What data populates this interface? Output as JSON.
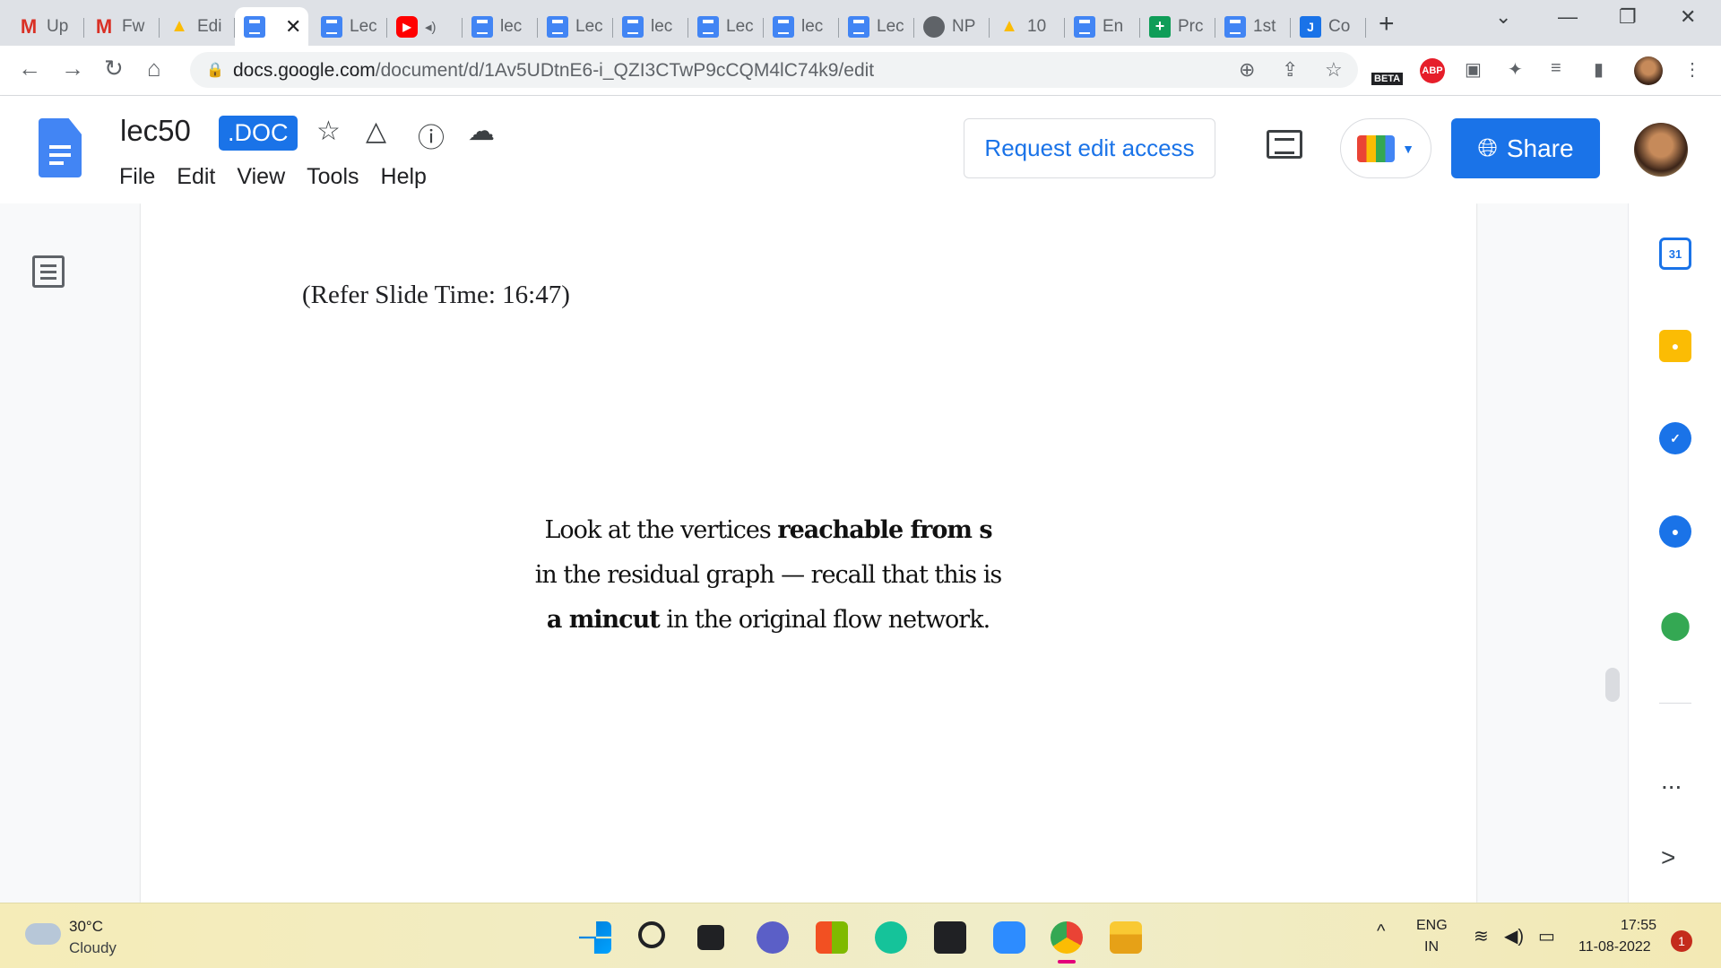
{
  "tabs": [
    {
      "title": "Up",
      "icon": "gmail-icon"
    },
    {
      "title": "Fw",
      "icon": "gmail-icon"
    },
    {
      "title": "Edi",
      "icon": "google-drive-icon"
    },
    {
      "title": "",
      "icon": "google-docs-icon",
      "active": true
    },
    {
      "title": "Lec",
      "icon": "google-docs-icon"
    },
    {
      "title": "",
      "icon": "youtube-icon"
    },
    {
      "title": "lec",
      "icon": "google-docs-icon"
    },
    {
      "title": "Lec",
      "icon": "google-docs-icon"
    },
    {
      "title": "lec",
      "icon": "google-docs-icon"
    },
    {
      "title": "Lec",
      "icon": "google-docs-icon"
    },
    {
      "title": "lec",
      "icon": "google-docs-icon"
    },
    {
      "title": "Lec",
      "icon": "google-docs-icon"
    },
    {
      "title": "NP",
      "icon": "globe-icon"
    },
    {
      "title": "10",
      "icon": "google-drive-icon"
    },
    {
      "title": "En",
      "icon": "google-docs-icon"
    },
    {
      "title": "Prc",
      "icon": "google-sheets-icon"
    },
    {
      "title": "1st",
      "icon": "google-docs-icon"
    },
    {
      "title": "Co",
      "icon": "j-icon"
    }
  ],
  "address_bar": {
    "domain": "docs.google.com",
    "path": "/document/d/1Av5UDtnE6-i_QZI3CTwP9cCQM4lC74k9/edit",
    "beta_label": "BETA",
    "abp_label": "ABP"
  },
  "docs": {
    "title": "lec50",
    "badge": ".DOC",
    "menu": [
      "File",
      "Edit",
      "View",
      "Tools",
      "Help"
    ],
    "request_edit_label": "Request edit access",
    "share_label": "Share"
  },
  "document": {
    "slide_ref": "(Refer Slide Time: 16:47)",
    "slide_lines": [
      {
        "parts": [
          {
            "text": "Look at the vertices ",
            "bold": false
          },
          {
            "text": "reachable from s",
            "bold": true
          }
        ]
      },
      {
        "parts": [
          {
            "text": "in the residual graph — recall that this is",
            "bold": false
          }
        ]
      },
      {
        "parts": [
          {
            "text": "a mincut",
            "bold": true
          },
          {
            "text": " in the original flow network.",
            "bold": false
          }
        ]
      }
    ]
  },
  "side_panel": {
    "calendar_day": "31",
    "more_label": "...",
    "expand_label": ">"
  },
  "taskbar": {
    "weather_temp": "30°C",
    "weather_desc": "Cloudy",
    "language_top": "ENG",
    "language_bottom": "IN",
    "time": "17:55",
    "date": "11-08-2022",
    "notification_count": "1"
  }
}
